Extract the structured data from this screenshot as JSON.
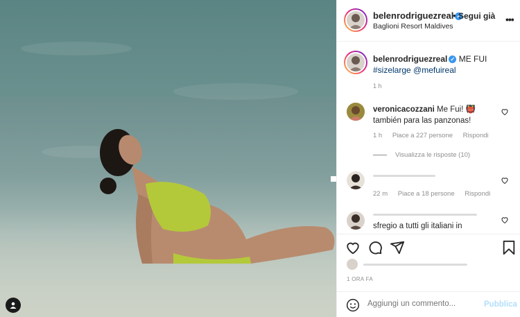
{
  "post": {
    "username": "belenrodriguezreal",
    "verified_mark": "✓",
    "dot": "•",
    "follow_status": "Segui già",
    "location": "Baglioni Resort Maldives",
    "more_label": "•••"
  },
  "caption": {
    "username": "belenrodriguezreal",
    "text": "ME FUI",
    "tags": "#sizelarge @mefuireal",
    "time": "1 h"
  },
  "comments": [
    {
      "username": "veronicacozzani",
      "text": "Me Fui! 👹 también para las panzonas!",
      "time": "1 h",
      "likes": "Piace a 227 persone",
      "reply": "Rispondi"
    },
    {
      "username": "",
      "text": "",
      "time": "22 m",
      "likes": "Piace a 18 persone",
      "reply": "Rispondi"
    },
    {
      "username": "",
      "text": "sfregio a tutti gli italiani in"
    }
  ],
  "view_replies": "Visualizza le risposte (10)",
  "post_time": "1 ORA FA",
  "comment_box": {
    "placeholder": "Aggiungi un commento...",
    "publish": "Pubblica"
  },
  "icons": [
    "heart-icon",
    "comment-icon",
    "share-icon",
    "bookmark-icon",
    "emoji-icon",
    "user-tag-icon",
    "more-icon"
  ]
}
